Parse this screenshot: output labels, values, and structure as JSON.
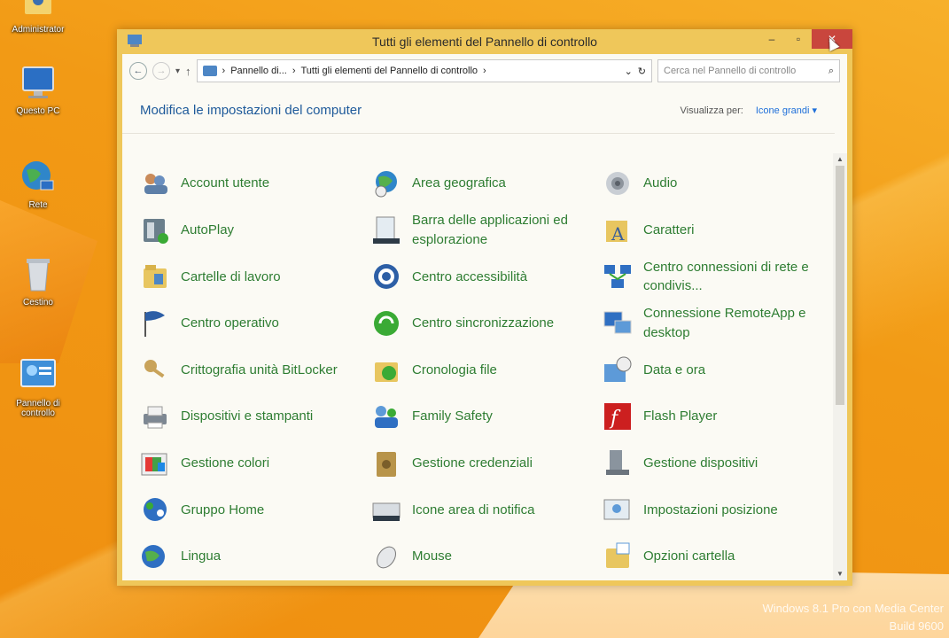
{
  "desktop": {
    "icons": [
      {
        "label": "Administrator",
        "icon": "user-folder-icon"
      },
      {
        "label": "Questo PC",
        "icon": "computer-icon"
      },
      {
        "label": "Rete",
        "icon": "network-globe-icon"
      },
      {
        "label": "Cestino",
        "icon": "recycle-bin-icon"
      },
      {
        "label": "Pannello di controllo",
        "icon": "control-panel-icon"
      }
    ],
    "watermark_line1": "Windows 8.1 Pro con Media Center",
    "watermark_line2": "Build 9600"
  },
  "window": {
    "title": "Tutti gli elementi del Pannello di controllo",
    "minimize": "–",
    "maximize": "▫",
    "close": "✕"
  },
  "address": {
    "back": "←",
    "forward": "→",
    "recent": "▾",
    "up": "↑",
    "crumb1": "Pannello di...",
    "sep": "›",
    "crumb2": "Tutti gli elementi del Pannello di controllo",
    "dropdown": "⌄",
    "refresh": "↻",
    "search_placeholder": "Cerca nel Pannello di controllo",
    "search_glyph": "⌕"
  },
  "header": {
    "title": "Modifica le impostazioni del computer",
    "viewby_label": "Visualizza per:",
    "viewby_value": "Icone grandi ▾"
  },
  "items": [
    {
      "label": "Account utente",
      "icon": "users-icon"
    },
    {
      "label": "Area geografica",
      "icon": "globe-clock-icon"
    },
    {
      "label": "Audio",
      "icon": "speaker-icon"
    },
    {
      "label": "AutoPlay",
      "icon": "autoplay-icon"
    },
    {
      "label": "Barra delle applicazioni ed esplorazione",
      "icon": "taskbar-icon"
    },
    {
      "label": "Caratteri",
      "icon": "fonts-folder-icon"
    },
    {
      "label": "Cartelle di lavoro",
      "icon": "work-folders-icon"
    },
    {
      "label": "Centro accessibilità",
      "icon": "accessibility-icon"
    },
    {
      "label": "Centro connessioni di rete e condivis...",
      "icon": "network-center-icon"
    },
    {
      "label": "Centro operativo",
      "icon": "flag-icon"
    },
    {
      "label": "Centro sincronizzazione",
      "icon": "sync-icon"
    },
    {
      "label": "Connessione RemoteApp e desktop",
      "icon": "remote-desktop-icon"
    },
    {
      "label": "Crittografia unità BitLocker",
      "icon": "bitlocker-key-icon"
    },
    {
      "label": "Cronologia file",
      "icon": "file-history-icon"
    },
    {
      "label": "Data e ora",
      "icon": "date-time-icon"
    },
    {
      "label": "Dispositivi e stampanti",
      "icon": "printer-icon"
    },
    {
      "label": "Family Safety",
      "icon": "family-safety-icon"
    },
    {
      "label": "Flash Player",
      "icon": "flash-icon"
    },
    {
      "label": "Gestione colori",
      "icon": "color-management-icon"
    },
    {
      "label": "Gestione credenziali",
      "icon": "credential-vault-icon"
    },
    {
      "label": "Gestione dispositivi",
      "icon": "device-manager-icon"
    },
    {
      "label": "Gruppo Home",
      "icon": "homegroup-icon"
    },
    {
      "label": "Icone area di notifica",
      "icon": "notification-area-icon"
    },
    {
      "label": "Impostazioni posizione",
      "icon": "location-icon"
    },
    {
      "label": "Lingua",
      "icon": "language-icon"
    },
    {
      "label": "Mouse",
      "icon": "mouse-icon"
    },
    {
      "label": "Opzioni cartella",
      "icon": "folder-options-icon"
    }
  ],
  "colors": {
    "desktop": "#f5a21a",
    "titlebar": "#efc75a",
    "link_green": "#2e7d32",
    "heading_blue": "#1e5a9a",
    "close_red": "#c9463d"
  }
}
